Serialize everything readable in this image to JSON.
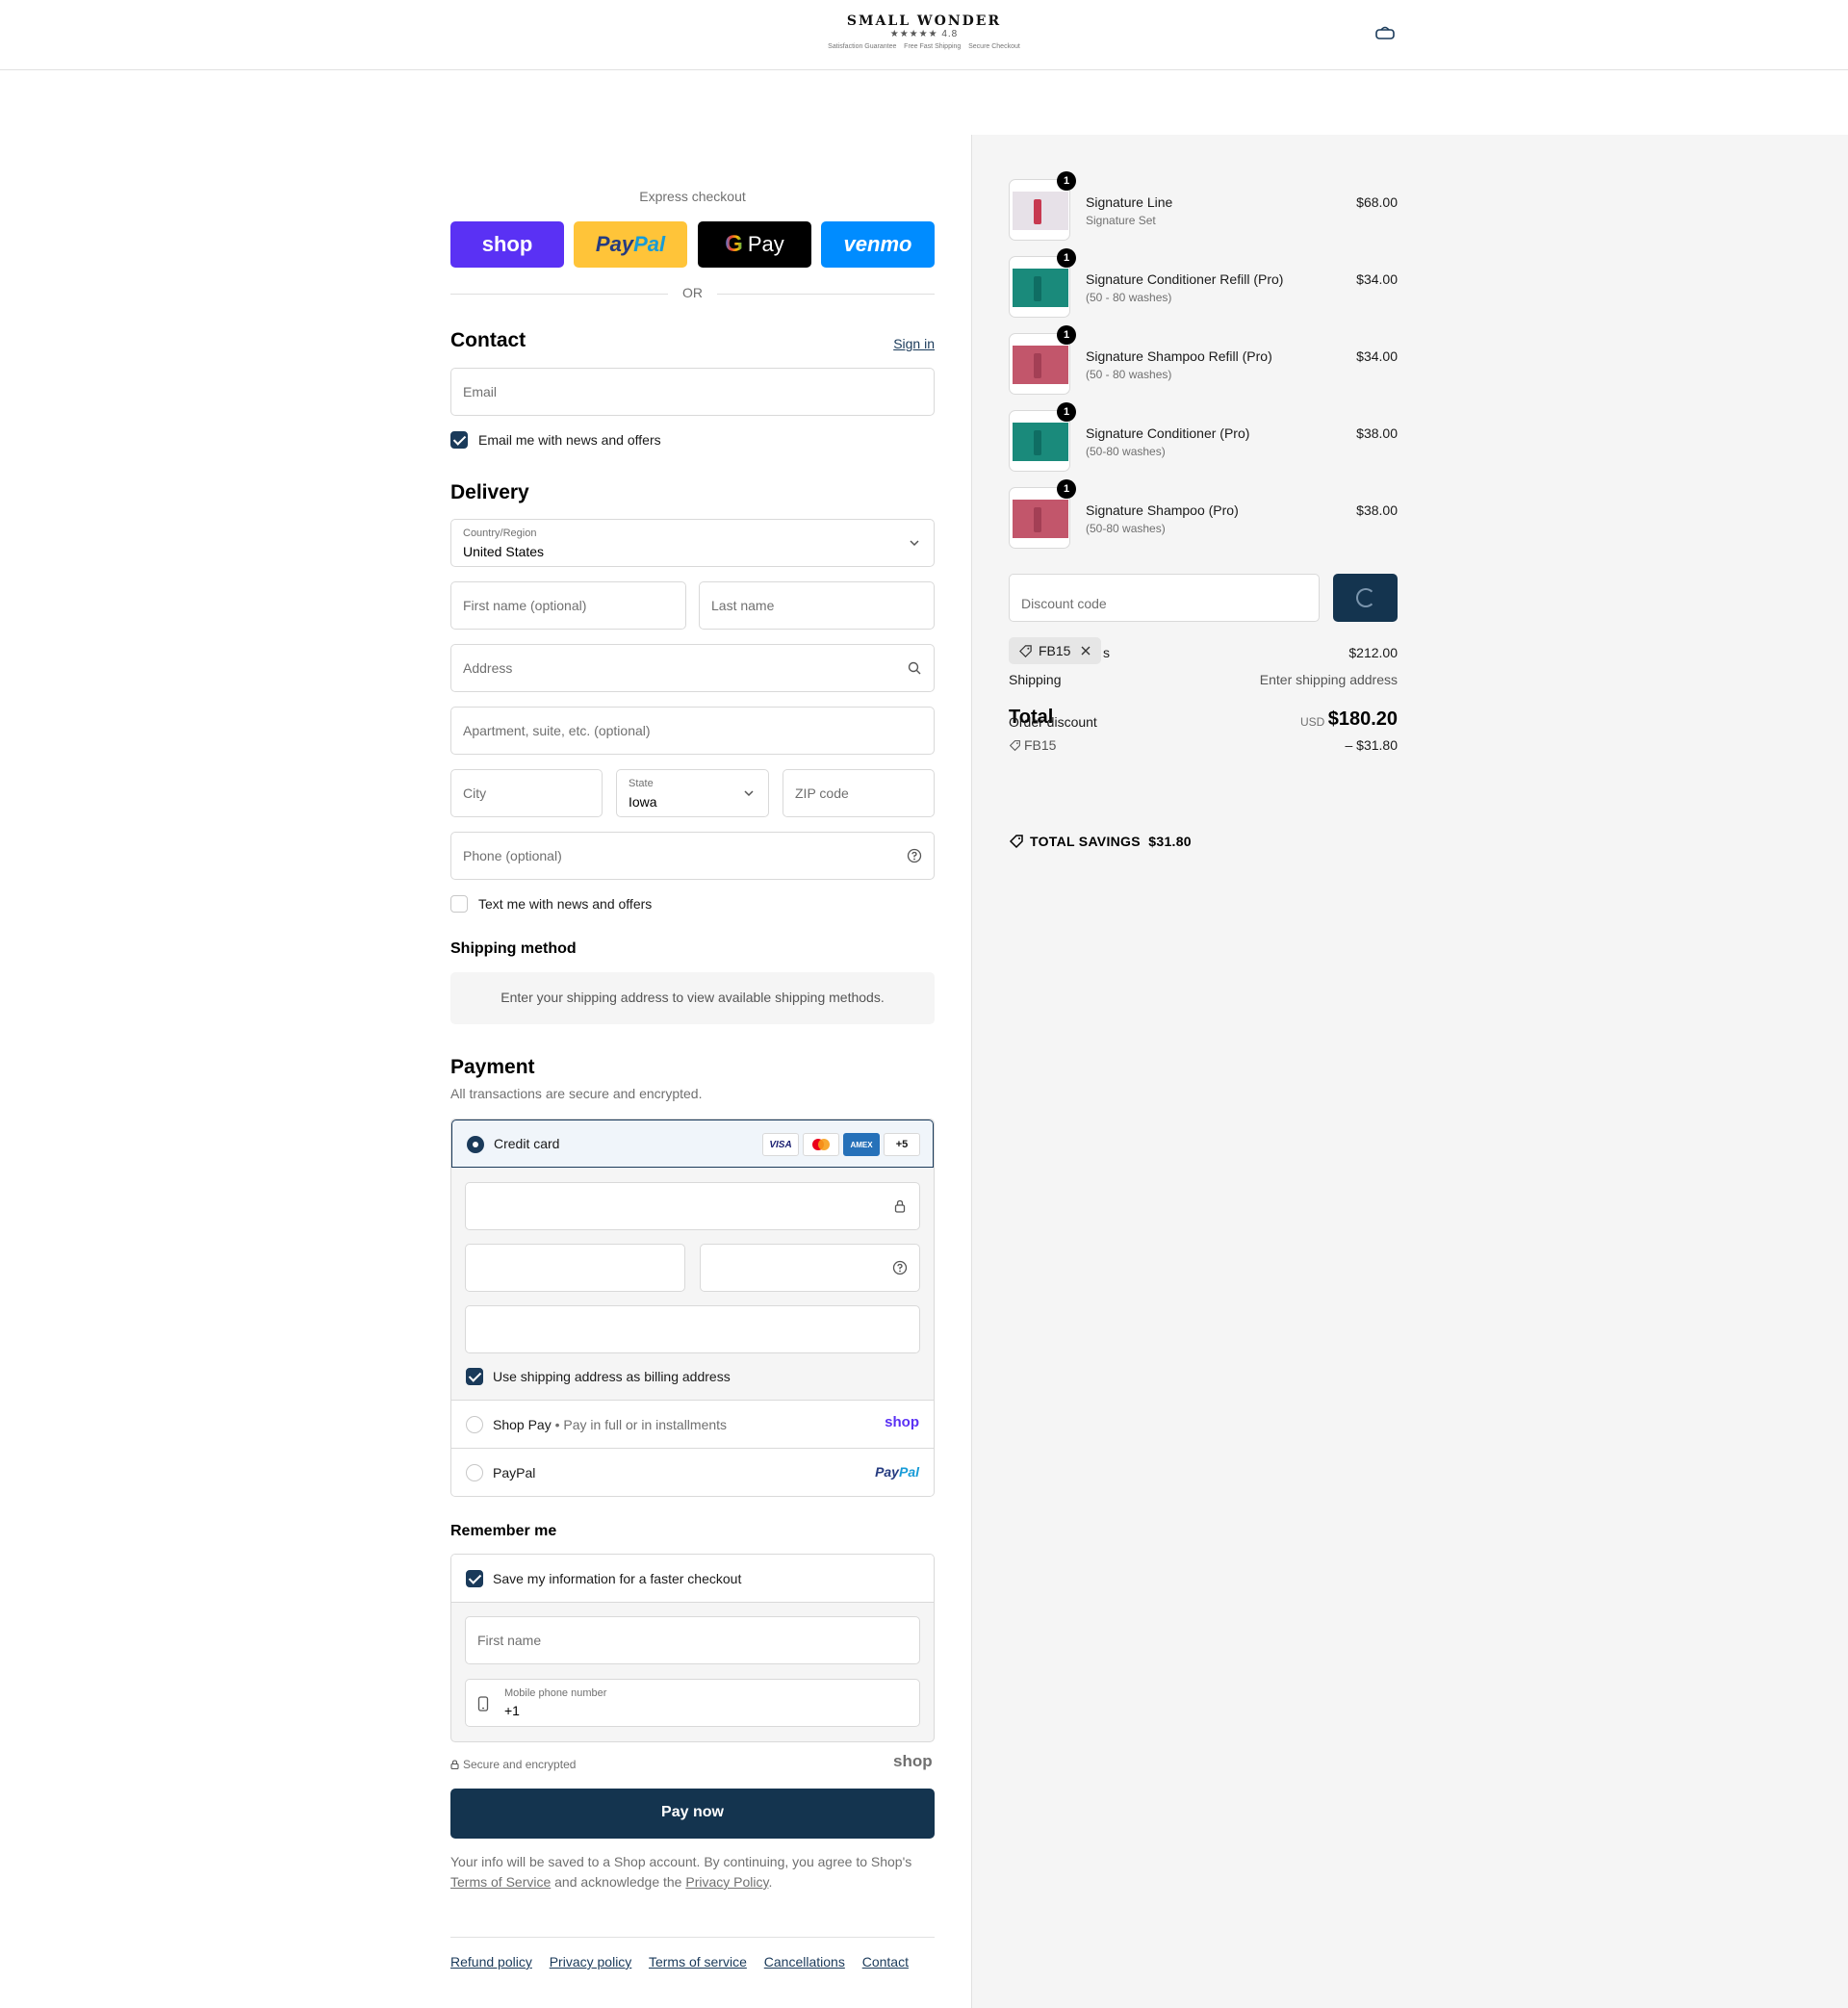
{
  "header": {
    "brand": "SMALL WONDER",
    "rating_text": "★★★★★ 4.8",
    "perks": [
      "Satisfaction Guarantee",
      "Free Fast Shipping",
      "Secure Checkout"
    ]
  },
  "express": {
    "title": "Express checkout",
    "shop_label": "shop",
    "paypal_pay": "Pay",
    "paypal_pal": "Pal",
    "gpay_g": "G",
    "gpay_label": "Pay",
    "venmo_label": "venmo",
    "or_label": "OR"
  },
  "contact": {
    "heading": "Contact",
    "sign_in": "Sign in",
    "email_placeholder": "Email",
    "email_optin": "Email me with news and offers"
  },
  "delivery": {
    "heading": "Delivery",
    "country_label": "Country/Region",
    "country_value": "United States",
    "first_name_placeholder": "First name (optional)",
    "last_name_placeholder": "Last name",
    "address_placeholder": "Address",
    "apartment_placeholder": "Apartment, suite, etc. (optional)",
    "city_placeholder": "City",
    "state_label": "State",
    "state_value": "Iowa",
    "zip_placeholder": "ZIP code",
    "phone_placeholder": "Phone (optional)",
    "text_optin": "Text me with news and offers"
  },
  "shipping_method": {
    "heading": "Shipping method",
    "message": "Enter your shipping address to view available shipping methods."
  },
  "payment": {
    "heading": "Payment",
    "subtitle": "All transactions are secure and encrypted.",
    "credit_card_label": "Credit card",
    "card_brands": [
      "VISA",
      "MC",
      "AMEX",
      "+5"
    ],
    "billing_same": "Use shipping address as billing address",
    "shop_pay_label": "Shop Pay",
    "shop_pay_sub": "Pay in full or in installments",
    "shop_pay_logo": "shop",
    "paypal_label": "PayPal",
    "paypal_logo_a": "Pay",
    "paypal_logo_b": "Pal"
  },
  "remember": {
    "heading": "Remember me",
    "save_info": "Save my information for a faster checkout",
    "first_name_placeholder": "First name",
    "mobile_label": "Mobile phone number",
    "mobile_value": "+1"
  },
  "secure_text": "Secure and encrypted",
  "shop_gray": "shop",
  "pay_now": "Pay now",
  "legal": {
    "text1": "Your info will be saved to a Shop account. By continuing, you agree to Shop's",
    "tos": "Terms of Service",
    "text2": "and acknowledge the",
    "privacy": "Privacy Policy",
    "text3": "."
  },
  "footer_links": [
    "Refund policy",
    "Privacy policy",
    "Terms of service",
    "Cancellations",
    "Contact"
  ],
  "summary": {
    "items": [
      {
        "name": "Signature Line",
        "variant": "Signature Set",
        "price": "$68.00",
        "qty": "1",
        "color": "#e7e1e8",
        "accent": "#c73950"
      },
      {
        "name": "Signature Conditioner Refill (Pro)",
        "variant": "(50 - 80 washes)",
        "price": "$34.00",
        "qty": "1",
        "color": "#1a8a7b",
        "accent": "#0f6d63"
      },
      {
        "name": "Signature Shampoo Refill (Pro)",
        "variant": "(50 - 80 washes)",
        "price": "$34.00",
        "qty": "1",
        "color": "#c2566b",
        "accent": "#a33f55"
      },
      {
        "name": "Signature Conditioner (Pro)",
        "variant": "(50-80 washes)",
        "price": "$38.00",
        "qty": "1",
        "color": "#1a8a7b",
        "accent": "#0f6d63"
      },
      {
        "name": "Signature Shampoo (Pro)",
        "variant": "(50-80 washes)",
        "price": "$38.00",
        "qty": "1",
        "color": "#c2566b",
        "accent": "#a33f55"
      }
    ],
    "discount_placeholder": "Discount code",
    "applied_code": "FB15",
    "subtotal_label": "s",
    "subtotal_value": "$212.00",
    "shipping_label": "Shipping",
    "shipping_value": "Enter shipping address",
    "total_label": "Total",
    "order_discount_label": "Order discount",
    "discount_code": "FB15",
    "discount_value": "– $31.80",
    "currency": "USD",
    "total_value": "$180.20",
    "savings_label": "TOTAL SAVINGS",
    "savings_value": "$31.80"
  }
}
